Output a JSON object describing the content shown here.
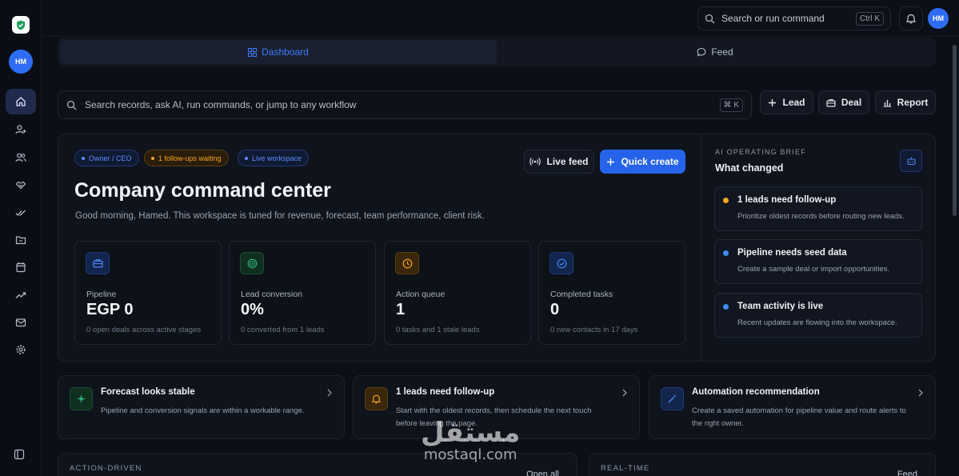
{
  "app": {
    "user_initials": "HM"
  },
  "topbar": {
    "search_placeholder": "Search or run command",
    "search_shortcut": "Ctrl K",
    "user_initials": "HM"
  },
  "sidebar": {
    "items": [
      {
        "icon": "home-icon",
        "active": true
      },
      {
        "icon": "user-plus-icon"
      },
      {
        "icon": "users-icon"
      },
      {
        "icon": "handshake-icon"
      },
      {
        "icon": "double-check-icon"
      },
      {
        "icon": "folder-icon"
      },
      {
        "icon": "calendar-icon"
      },
      {
        "icon": "trending-up-icon"
      },
      {
        "icon": "mail-icon"
      },
      {
        "icon": "gear-icon"
      }
    ]
  },
  "tabs": [
    {
      "label": "Dashboard",
      "active": true
    },
    {
      "label": "Feed",
      "active": false
    }
  ],
  "search": {
    "placeholder": "Search records, ask AI, run commands, or jump to any workflow",
    "shortcut": "⌘ K"
  },
  "quick_actions": [
    {
      "label": "Lead",
      "icon": "plus-icon"
    },
    {
      "label": "Deal",
      "icon": "briefcase-icon"
    },
    {
      "label": "Report",
      "icon": "bar-chart-icon"
    }
  ],
  "hero": {
    "chips": [
      {
        "label": "Owner / CEO",
        "tone": "blue"
      },
      {
        "label": "1 follow-ups waiting",
        "tone": "amber"
      },
      {
        "label": "Live workspace",
        "tone": "blue"
      }
    ],
    "live_feed_label": "Live feed",
    "quick_create_label": "Quick create",
    "title": "Company command center",
    "subtitle": "Good morning, Hamed. This workspace is tuned for revenue, forecast, team performance, client risk.",
    "stats": [
      {
        "icon": "briefcase-icon",
        "label": "Pipeline",
        "value": "EGP 0",
        "note": "0 open deals across active stages",
        "color": "#3b6fe0"
      },
      {
        "icon": "target-icon",
        "label": "Lead conversion",
        "value": "0%",
        "note": "0 converted from 1 leads",
        "color": "#2fb57a"
      },
      {
        "icon": "clock-icon",
        "label": "Action queue",
        "value": "1",
        "note": "0 tasks and 1 stale leads",
        "color": "#f5a623"
      },
      {
        "icon": "check-circle-icon",
        "label": "Completed tasks",
        "value": "0",
        "note": "0 new contacts in 17 days",
        "color": "#3d8bff"
      }
    ]
  },
  "brief": {
    "kicker": "AI OPERATING BRIEF",
    "title": "What changed",
    "items": [
      {
        "title": "1 leads need follow-up",
        "desc": "Prioritize oldest records before routing new leads.",
        "color": "#f5a623"
      },
      {
        "title": "Pipeline needs seed data",
        "desc": "Create a sample deal or import opportunities.",
        "color": "#3d8bff"
      },
      {
        "title": "Team activity is live",
        "desc": "Recent updates are flowing into the workspace.",
        "color": "#3d8bff"
      }
    ]
  },
  "insights": [
    {
      "icon": "sparkle-icon",
      "title": "Forecast looks stable",
      "desc_1": "Pipeline and conversion signals are within a workable range.",
      "desc_2": "",
      "color": "#2fb57a"
    },
    {
      "icon": "bell-icon",
      "title": "1 leads need follow-up",
      "desc_1": "Start with the oldest records, then schedule the next touch",
      "desc_2": "before leaving the page.",
      "color": "#f5a623"
    },
    {
      "icon": "wand-icon",
      "title": "Automation recommendation",
      "desc_1": "Create a saved automation for pipeline value and route alerts to",
      "desc_2": "the right owner.",
      "color": "#3d8bff"
    }
  ],
  "panels": [
    {
      "kicker": "ACTION-DRIVEN",
      "link": "Open all"
    },
    {
      "kicker": "REAL-TIME",
      "link": "Feed"
    }
  ],
  "watermark": {
    "arabic": "مستقل",
    "latin": "mostaql.com"
  }
}
